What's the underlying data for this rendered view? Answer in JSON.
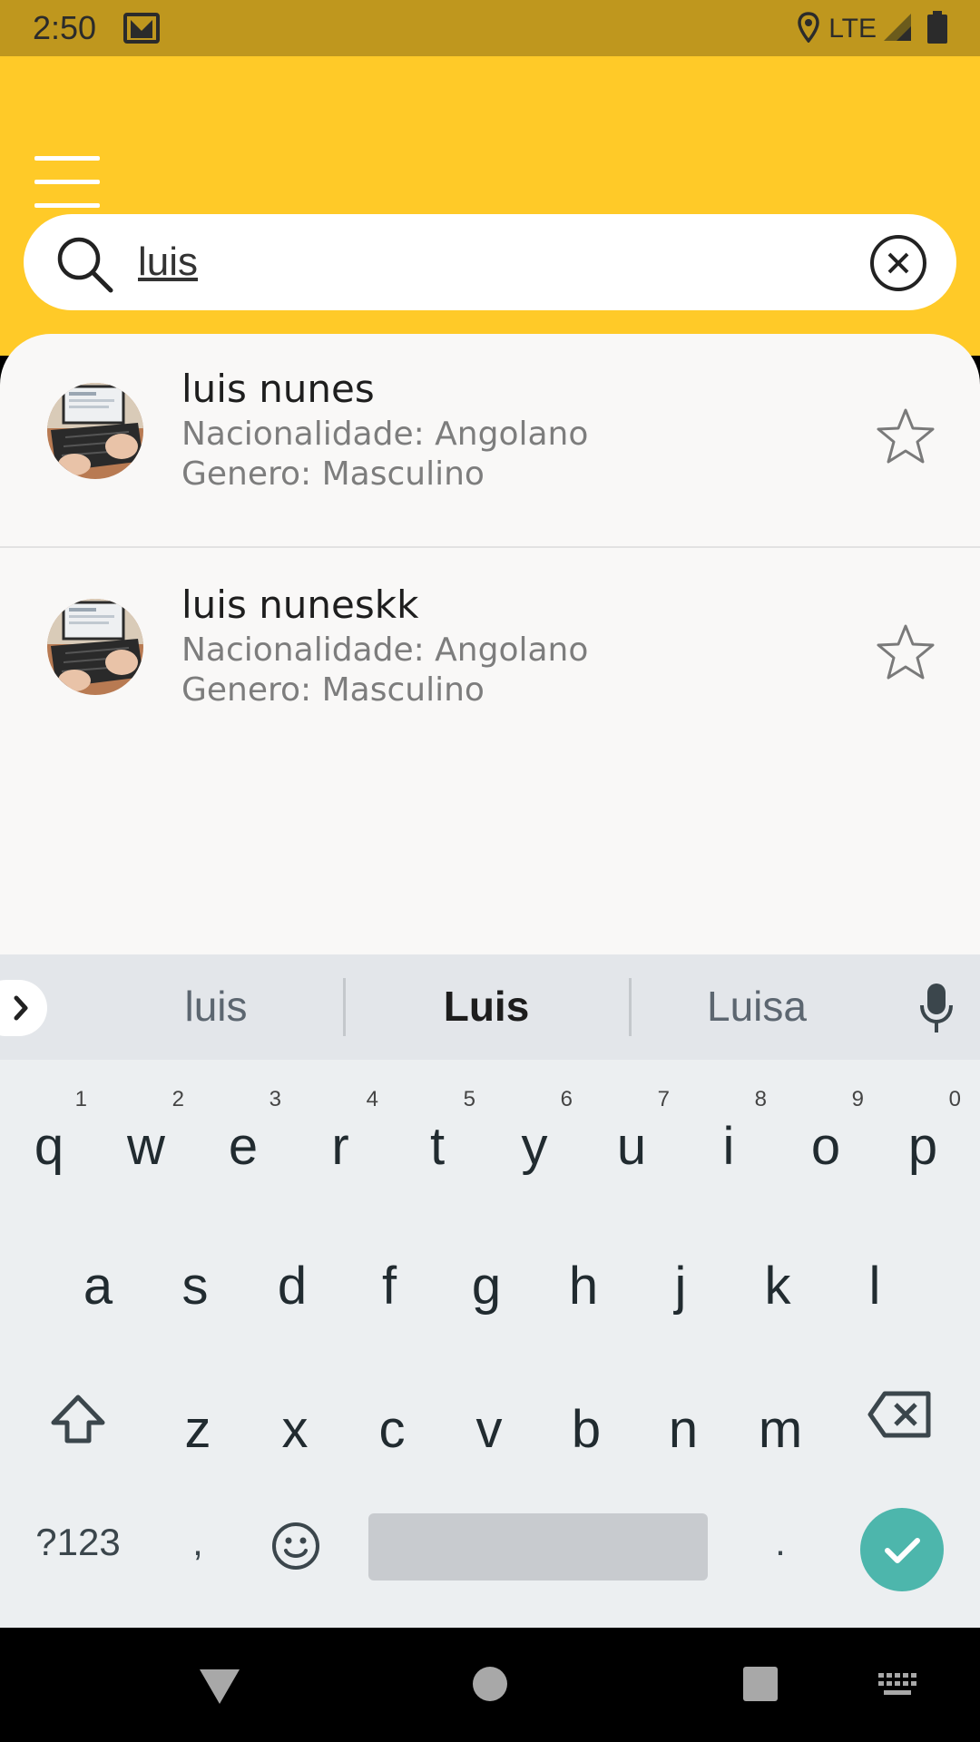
{
  "status_bar": {
    "time": "2:50",
    "network": "LTE"
  },
  "search": {
    "value": "luis"
  },
  "results": [
    {
      "name": "luis nunes",
      "nationality": "Nacionalidade: Angolano",
      "gender": "Genero: Masculino"
    },
    {
      "name": "luis nuneskk",
      "nationality": "Nacionalidade: Angolano",
      "gender": "Genero: Masculino"
    }
  ],
  "keyboard": {
    "suggestions": [
      "luis",
      "Luis",
      "Luisa"
    ],
    "row1": [
      {
        "k": "q",
        "n": "1"
      },
      {
        "k": "w",
        "n": "2"
      },
      {
        "k": "e",
        "n": "3"
      },
      {
        "k": "r",
        "n": "4"
      },
      {
        "k": "t",
        "n": "5"
      },
      {
        "k": "y",
        "n": "6"
      },
      {
        "k": "u",
        "n": "7"
      },
      {
        "k": "i",
        "n": "8"
      },
      {
        "k": "o",
        "n": "9"
      },
      {
        "k": "p",
        "n": "0"
      }
    ],
    "row2": [
      "a",
      "s",
      "d",
      "f",
      "g",
      "h",
      "j",
      "k",
      "l"
    ],
    "row3": [
      "z",
      "x",
      "c",
      "v",
      "b",
      "n",
      "m"
    ],
    "symbols_label": "?123",
    "comma": ",",
    "period": "."
  },
  "colors": {
    "status_bar": "#BF971E",
    "header": "#FFCA28",
    "enter": "#4DB6AC"
  },
  "icons": [
    "mail-icon",
    "location-icon",
    "signal-icon",
    "battery-icon",
    "menu-icon",
    "search-icon",
    "clear-icon",
    "star-icon",
    "mic-icon",
    "shift-icon",
    "backspace-icon",
    "emoji-icon",
    "check-icon",
    "back-icon",
    "home-icon",
    "recents-icon",
    "keyboard-icon"
  ]
}
